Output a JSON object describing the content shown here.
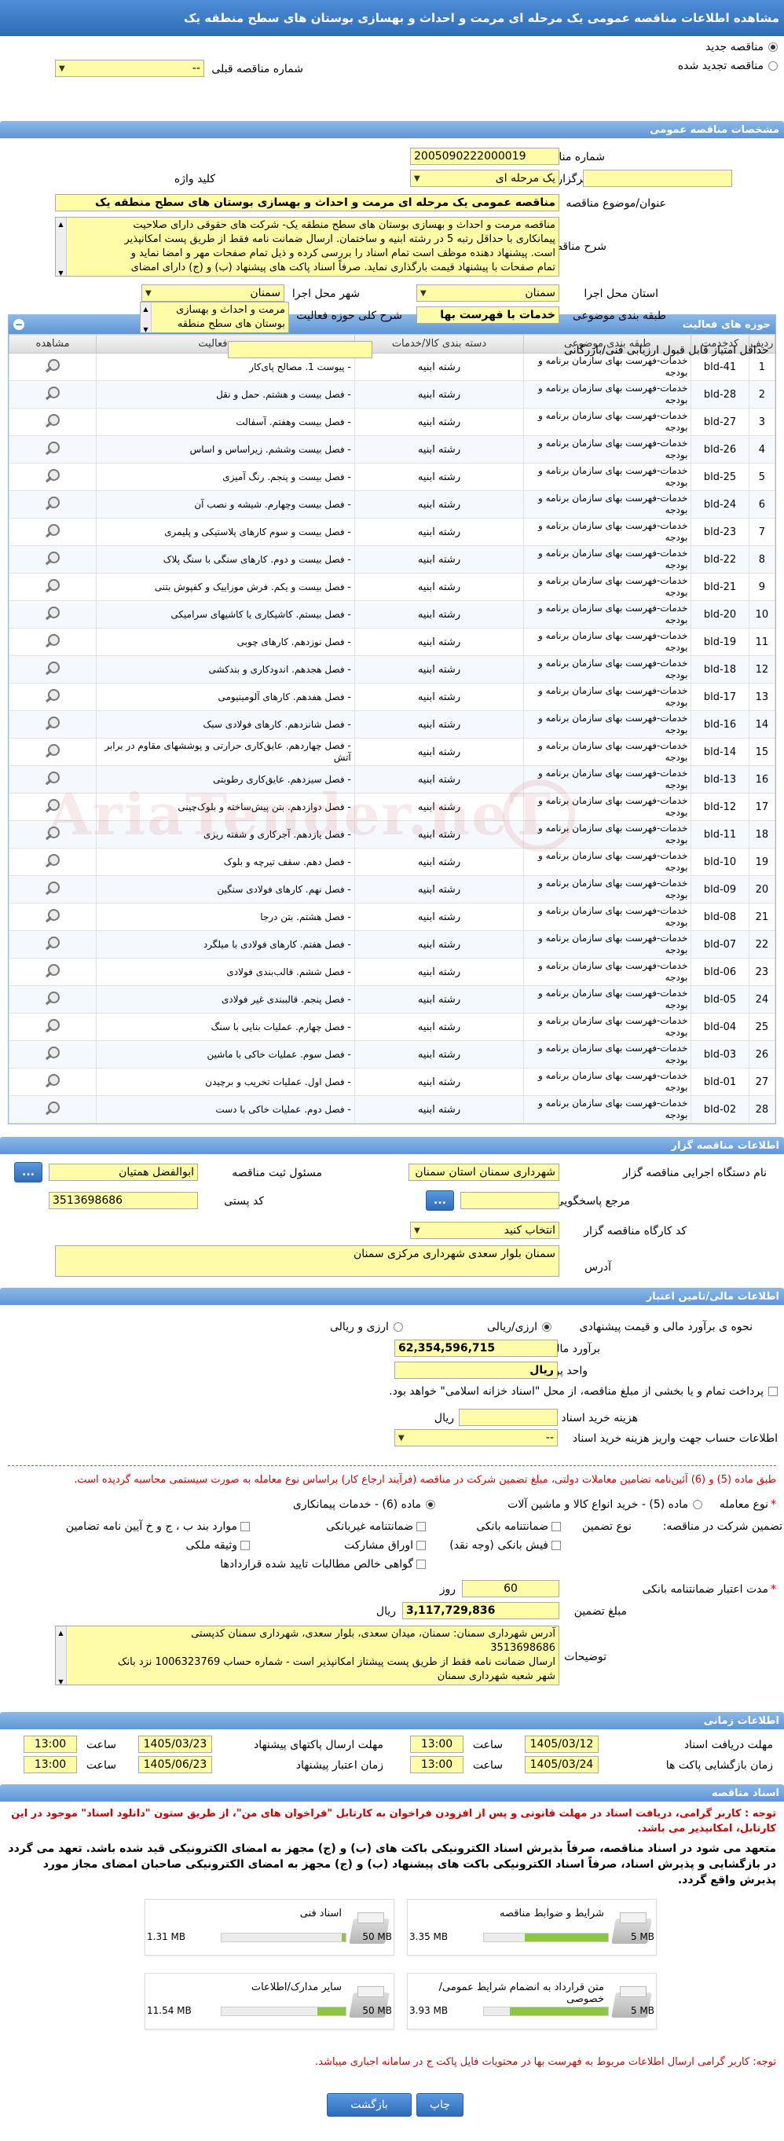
{
  "title": "مشاهده اطلاعات مناقصه عمومی یک مرحله ای مرمت و احداث و بهسازی بوستان های سطح منطقه یک",
  "tender_status": {
    "new_label": "مناقصه جدید",
    "renewed_label": "مناقصه تجدید شده",
    "previous_number_label": "شماره مناقصه قبلی",
    "previous_number_value": "--"
  },
  "general": {
    "section_title": "مشخصات مناقصه عمومی",
    "number_label": "شماره مناقصه",
    "number_value": "2005090222000019",
    "holding_type_label": "نوع برگزاری",
    "holding_type_value": "یک مرحله ای",
    "keyword_label": "کلید واژه",
    "keyword_value": "",
    "subject_label": "عنوان/موضوع مناقصه",
    "subject_value": "مناقصه عمومی یک مرحله ای مرمت و احداث و بهسازی بوستان های سطح منطقه یک",
    "description_label": "شرح مناقصه",
    "description_lines": [
      "مناقصه مرمت و احداث و بهسازی بوستان های سطح منطقه یک- شرکت های حقوقی دارای صلاحیت",
      "پیمانکاری با حداقل رتبه 5 در رشته ابنیه و ساختمان. ارسال ضمانت نامه فقط از طریق پست امکانپذیر",
      "است. پیشنهاد دهنده موظف است تمام اسناد را بررسی کرده و ذیل تمام صفحات مهر و امضا نماید و",
      "تمام صفحات با پیشنهاد قیمت بارگذاری نماید. صرفاً اسناد پاکت های پیشنهاد (ب) و (ج) دارای امضای"
    ],
    "province_label": "استان محل اجرا",
    "province_value": "سمنان",
    "city_label": "شهر محل اجرا",
    "city_value": "سمنان",
    "subject_class_label": "طبقه بندی موضوعی",
    "subject_class_value": "خدمات با فهرست بها",
    "activity_desc_label": "شرح کلی حوزه فعالیت",
    "activity_desc_lines": [
      "مرمت و احداث و بهسازی",
      "بوستان های سطح منطقه"
    ],
    "min_score_label": "حداقل امتیاز قابل قبول ارزیابی فنی/بازرگانی",
    "min_score_value": ""
  },
  "activities": {
    "section_title": "حوزه های فعالیت",
    "columns": [
      "ردیف",
      "کدخدمت",
      "طبقه بندی موضوعی",
      "دسته بندی کالا/خدمات",
      "حوزه فعالیت",
      "مشاهده"
    ],
    "rows": [
      {
        "n": "1",
        "code": "bld-41",
        "type": "خدمات-فهرست بهای سازمان برنامه و بودجه",
        "cat": "رشته ابنیه",
        "act": "- پیوست 1. مصالح پای‌کار"
      },
      {
        "n": "2",
        "code": "bld-28",
        "type": "خدمات-فهرست بهای سازمان برنامه و بودجه",
        "cat": "رشته ابنیه",
        "act": "- فصل بیست و هشتم. حمل و نقل"
      },
      {
        "n": "3",
        "code": "bld-27",
        "type": "خدمات-فهرست بهای سازمان برنامه و بودجه",
        "cat": "رشته ابنیه",
        "act": "- فصل بیست وهفتم. آسفالت"
      },
      {
        "n": "4",
        "code": "bld-26",
        "type": "خدمات-فهرست بهای سازمان برنامه و بودجه",
        "cat": "رشته ابنیه",
        "act": "- فصل بیست وششم. زیراساس و اساس"
      },
      {
        "n": "5",
        "code": "bld-25",
        "type": "خدمات-فهرست بهای سازمان برنامه و بودجه",
        "cat": "رشته ابنیه",
        "act": "- فصل بیست و پنجم. رنگ آمیزی"
      },
      {
        "n": "6",
        "code": "bld-24",
        "type": "خدمات-فهرست بهای سازمان برنامه و بودجه",
        "cat": "رشته ابنیه",
        "act": "- فصل بیست وچهارم. شیشه و نصب آن"
      },
      {
        "n": "7",
        "code": "bld-23",
        "type": "خدمات-فهرست بهای سازمان برنامه و بودجه",
        "cat": "رشته ابنیه",
        "act": "- فصل بیست و سوم کارهای پلاستیکی و پلیمری"
      },
      {
        "n": "8",
        "code": "bld-22",
        "type": "خدمات-فهرست بهای سازمان برنامه و بودجه",
        "cat": "رشته ابنیه",
        "act": "- فصل بیست و دوم. کارهای سنگی با سنگ پلاک"
      },
      {
        "n": "9",
        "code": "bld-21",
        "type": "خدمات-فهرست بهای سازمان برنامه و بودجه",
        "cat": "رشته ابنیه",
        "act": "- فصل بیست و یکم. فرش موزاییک و کفپوش بتنی"
      },
      {
        "n": "10",
        "code": "bld-20",
        "type": "خدمات-فهرست بهای سازمان برنامه و بودجه",
        "cat": "رشته ابنیه",
        "act": "- فصل بیستم. کاشیکاری یا کاشیهای سرامیکی"
      },
      {
        "n": "11",
        "code": "bld-19",
        "type": "خدمات-فهرست بهای سازمان برنامه و بودجه",
        "cat": "رشته ابنیه",
        "act": "- فصل نوزدهم. کارهای چوبی"
      },
      {
        "n": "12",
        "code": "bld-18",
        "type": "خدمات-فهرست بهای سازمان برنامه و بودجه",
        "cat": "رشته ابنیه",
        "act": "- فصل هجدهم. اندودکاری و بندکشی"
      },
      {
        "n": "13",
        "code": "bld-17",
        "type": "خدمات-فهرست بهای سازمان برنامه و بودجه",
        "cat": "رشته ابنیه",
        "act": "- فصل هفدهم. کارهای آلومینیومی"
      },
      {
        "n": "14",
        "code": "bld-16",
        "type": "خدمات-فهرست بهای سازمان برنامه و بودجه",
        "cat": "رشته ابنیه",
        "act": "- فصل شانزدهم. کارهای فولادی سبک"
      },
      {
        "n": "15",
        "code": "bld-14",
        "type": "خدمات-فهرست بهای سازمان برنامه و بودجه",
        "cat": "رشته ابنیه",
        "act": "- فصل چهاردهم. عایق‌کاری حرارتی و پوششهای مقاوم در برابر آتش"
      },
      {
        "n": "16",
        "code": "bld-13",
        "type": "خدمات-فهرست بهای سازمان برنامه و بودجه",
        "cat": "رشته ابنیه",
        "act": "- فصل سیزدهم. عایق‌کاری رطوبتی"
      },
      {
        "n": "17",
        "code": "bld-12",
        "type": "خدمات-فهرست بهای سازمان برنامه و بودجه",
        "cat": "رشته ابنیه",
        "act": "- فصل دوازدهم. بتن پیش‌ساخته و بلوک‌چینی"
      },
      {
        "n": "18",
        "code": "bld-11",
        "type": "خدمات-فهرست بهای سازمان برنامه و بودجه",
        "cat": "رشته ابنیه",
        "act": "- فصل یازدهم. آجرکاری و شفته ریزی"
      },
      {
        "n": "19",
        "code": "bld-10",
        "type": "خدمات-فهرست بهای سازمان برنامه و بودجه",
        "cat": "رشته ابنیه",
        "act": "- فصل دهم. سقف تیرچه و بلوک"
      },
      {
        "n": "20",
        "code": "bld-09",
        "type": "خدمات-فهرست بهای سازمان برنامه و بودجه",
        "cat": "رشته ابنیه",
        "act": "- فصل نهم. کارهای فولادی سنگین"
      },
      {
        "n": "21",
        "code": "bld-08",
        "type": "خدمات-فهرست بهای سازمان برنامه و بودجه",
        "cat": "رشته ابنیه",
        "act": "- فصل هشتم. بتن درجا"
      },
      {
        "n": "22",
        "code": "bld-07",
        "type": "خدمات-فهرست بهای سازمان برنامه و بودجه",
        "cat": "رشته ابنیه",
        "act": "- فصل هفتم. کارهای فولادی با میلگرد"
      },
      {
        "n": "23",
        "code": "bld-06",
        "type": "خدمات-فهرست بهای سازمان برنامه و بودجه",
        "cat": "رشته ابنیه",
        "act": "- فصل ششم. قالب‌بندی فولادی"
      },
      {
        "n": "24",
        "code": "bld-05",
        "type": "خدمات-فهرست بهای سازمان برنامه و بودجه",
        "cat": "رشته ابنیه",
        "act": "- فصل پنجم. قالببندی غیر فولادی"
      },
      {
        "n": "25",
        "code": "bld-04",
        "type": "خدمات-فهرست بهای سازمان برنامه و بودجه",
        "cat": "رشته ابنیه",
        "act": "- فصل چهارم. عملیات بنایی با سنگ"
      },
      {
        "n": "26",
        "code": "bld-03",
        "type": "خدمات-فهرست بهای سازمان برنامه و بودجه",
        "cat": "رشته ابنیه",
        "act": "- فصل سوم. عملیات خاکی با ماشین"
      },
      {
        "n": "27",
        "code": "bld-01",
        "type": "خدمات-فهرست بهای سازمان برنامه و بودجه",
        "cat": "رشته ابنیه",
        "act": "- فصل اول. عملیات تخریب و برچیدن"
      },
      {
        "n": "28",
        "code": "bld-02",
        "type": "خدمات-فهرست بهای سازمان برنامه و بودجه",
        "cat": "رشته ابنیه",
        "act": "- فصل دوم. عملیات خاکی با دست"
      }
    ]
  },
  "watermark": "AriaTender.neT",
  "organizer": {
    "section_title": "اطلاعات مناقصه گزار",
    "device_label": "نام دستگاه اجرایی مناقصه گزار",
    "device_value": "شهرداری سمنان استان سمنان",
    "registrar_label": "مسئول ثبت مناقصه",
    "registrar_value": "ابوالفضل همتیان",
    "dots": "...",
    "ref_label": "مرجع پاسخگویی",
    "ref_value": "",
    "postal_label": "کد پستی",
    "postal_value": "3513698686",
    "workshop_label": "کد کارگاه مناقصه گزار",
    "workshop_value": "انتخاب کنید",
    "address_label": "آدرس",
    "address_value": "سمنان بلوار سعدی شهرداری مرکزی سمنان"
  },
  "finance": {
    "section_title": "اطلاعات مالی/تامین اعتبار",
    "estimate_label": "نحوه ی برآورد مالی و قیمت پیشنهادی",
    "opt_currency": "ارزی/ریالی",
    "opt_currency2": "ارزی و ریالی",
    "estimate_value_label": "برآورد مالی",
    "estimate_value": "62,354,596,715",
    "unit_label": "واحد پول",
    "unit_value": "ریال",
    "islamic_label": "پرداخت تمام و یا بخشی از مبلغ مناقصه، از محل \"اسناد خزانه اسلامی\" خواهد بود.",
    "doc_fee_label": "هزینه خرید اسناد",
    "doc_fee_unit": "ریال",
    "doc_fee_value": "",
    "account_label": "اطلاعات حساب جهت واریز هزینه خرید اسناد",
    "account_value": "--"
  },
  "guarantee": {
    "note": "طبق ماده (5) و (6) آئین‌نامه تضامین معاملات دولتی، مبلغ تضمین شرکت در مناقصه (فرآیند ارجاع کار) براساس نوع معامله به صورت سیستمی محاسبه گردیده است.",
    "deal_type_label": "نوع معامله",
    "deal_5": "ماده (5) - خرید انواع کالا و ماشین آلات",
    "deal_6": "ماده (6) - خدمات پیمانکاری",
    "guarantee_label": "تضمین شرکت در مناقصه:",
    "guarantee_type_label": "نوع تضمین",
    "opt_bank": "ضمانتنامه بانکی",
    "opt_nonbank": "ضمانتنامه غیربانکی",
    "opt_items": "موارد بند ب ، ج و خ آیین نامه تضامین",
    "opt_check": "فیش بانکی (وجه نقد)",
    "opt_bonds": "اوراق مشارکت",
    "opt_property": "وثیقه ملکی",
    "opt_certificate": "گواهی خالص مطالبات تایید شده قراردادها",
    "validity_label": "مدت اعتبار ضمانتنامه بانکی",
    "validity_value": "60",
    "validity_unit": "روز",
    "amount_label": "مبلغ تضمین",
    "amount_value": "3,117,729,836",
    "amount_unit": "ریال",
    "desc_label": "توضیحات",
    "desc_lines": [
      "آدرس شهرداری سمنان: سمنان، میدان سعدی، بلوار سعدی، شهرداری سمنان کدپستی",
      "3513698686",
      "ارسال ضمانت نامه فقط از طریق پست پیشتاز امکانپذیر است - شماره حساب 1006323769 نزد بانک",
      "شهر شعبه شهرداری سمنان"
    ]
  },
  "timing": {
    "section_title": "اطلاعات زمانی",
    "doc_receive_label": "مهلت دریافت اسناد",
    "doc_receive_date": "1405/03/12",
    "send_deadline_label": "مهلت ارسال پاکتهای پیشنهاد",
    "send_deadline_date": "1405/03/23",
    "open_label": "زمان بازگشایی پاکت ها",
    "open_date": "1405/03/24",
    "validity_label": "زمان اعتبار پیشنهاد",
    "validity_date": "1405/06/23",
    "time_label": "ساعت",
    "time_value": "13:00"
  },
  "documents": {
    "section_title": "اسناد مناقصه",
    "red_note": "توجه : کاربر گرامی، دریافت اسناد در مهلت قانونی و پس از افزودن فراخوان به کارتابل \"فراخوان های من\"، از طریق ستون \"دانلود اسناد\" موجود در این کارتابل، امکانپذیر می باشد.",
    "black_note": "متعهد می شود در اسناد مناقصه، صرفاً بذیرش اسناد الکترونیکی باکت های (ب) و (ج) مجهز به امضای الکترونیکی قید شده باشد. تعهد می گردد در بازگشایی و پذیرش اسناد، صرفاً اسناد الکترونیکی باکت های پیشنهاد (ب) و (ج) مجهز به امضای الکترونیکی صاحبان امضای مجاز مورد پذیرش واقع گردد.",
    "max_label": "MB",
    "cards": [
      {
        "title": "شرایط و ضوابط مناقصه",
        "used": "3.35 MB",
        "max": "5 MB",
        "fraction": 0.67
      },
      {
        "title": "اسناد فنی",
        "used": "1.31 MB",
        "max": "50 MB",
        "fraction": 0.03
      },
      {
        "title": "متن قرارداد به انضمام شرایط عمومی/خصوصی",
        "used": "3.93 MB",
        "max": "5 MB",
        "fraction": 0.79
      },
      {
        "title": "سایر مدارک/اطلاعات",
        "used": "11.54 MB",
        "max": "50 MB",
        "fraction": 0.23
      }
    ],
    "bottom_note": "توجه: کاربر گرامی ارسال اطلاعات مربوط به فهرست بها در محتویات فایل پاکت ج در سامانه اجباری میباشد."
  },
  "buttons": {
    "return": "بازگشت",
    "print": "چاپ"
  }
}
